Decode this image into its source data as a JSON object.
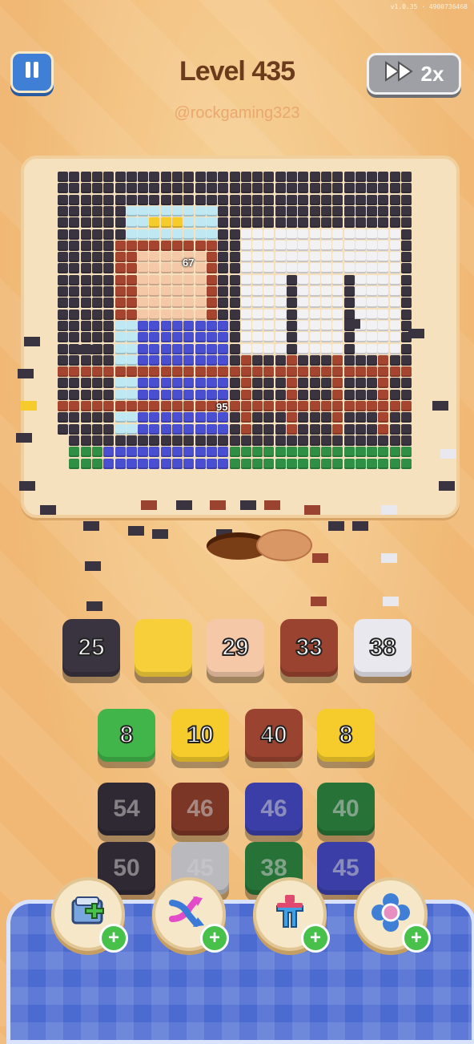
{
  "status": {
    "version": "v1.0.35 · 4900736468"
  },
  "header": {
    "pause_icon": "pause-icon",
    "title": "Level 435",
    "username": "@rockgaming323",
    "speed_icon": "fast-forward-icon",
    "speed_label": "2x"
  },
  "board": {
    "badges": [
      {
        "value": "67"
      },
      {
        "value": "95"
      }
    ]
  },
  "queue_slots": [
    {
      "value": "25",
      "color": "#3a3340"
    },
    {
      "value": "",
      "color": "#f7cf3a"
    },
    {
      "value": "29",
      "color": "#f5c9a8"
    },
    {
      "value": "33",
      "color": "#9a4330"
    },
    {
      "value": "38",
      "color": "#e8e8ee"
    }
  ],
  "tiles": [
    [
      {
        "value": "8",
        "color": "#41b54a"
      },
      {
        "value": "10",
        "color": "#f6cc2c"
      },
      {
        "value": "40",
        "color": "#9a4330"
      },
      {
        "value": "8",
        "color": "#f6cc2c"
      }
    ],
    [
      {
        "value": "54",
        "color": "#3a3340"
      },
      {
        "value": "46",
        "color": "#9a4330"
      },
      {
        "value": "46",
        "color": "#4a4ed0"
      },
      {
        "value": "40",
        "color": "#2f8f45"
      }
    ],
    [
      {
        "value": "50",
        "color": "#3a3340"
      },
      {
        "value": "45",
        "color": "#e8e8ee"
      },
      {
        "value": "38",
        "color": "#2f8f45"
      },
      {
        "value": "45",
        "color": "#4a4ed0"
      }
    ]
  ],
  "boosters": [
    {
      "name": "add-slot-booster",
      "icon": "add-box-icon"
    },
    {
      "name": "shuffle-booster",
      "icon": "shuffle-icon"
    },
    {
      "name": "magnet-booster",
      "icon": "magnet-icon"
    },
    {
      "name": "freeze-booster",
      "icon": "flower-icon"
    }
  ],
  "colors": {
    "background": "#f3c27f",
    "board": "#f6e1bf",
    "tray": "#4c6bd1",
    "plus": "#47c14a"
  }
}
